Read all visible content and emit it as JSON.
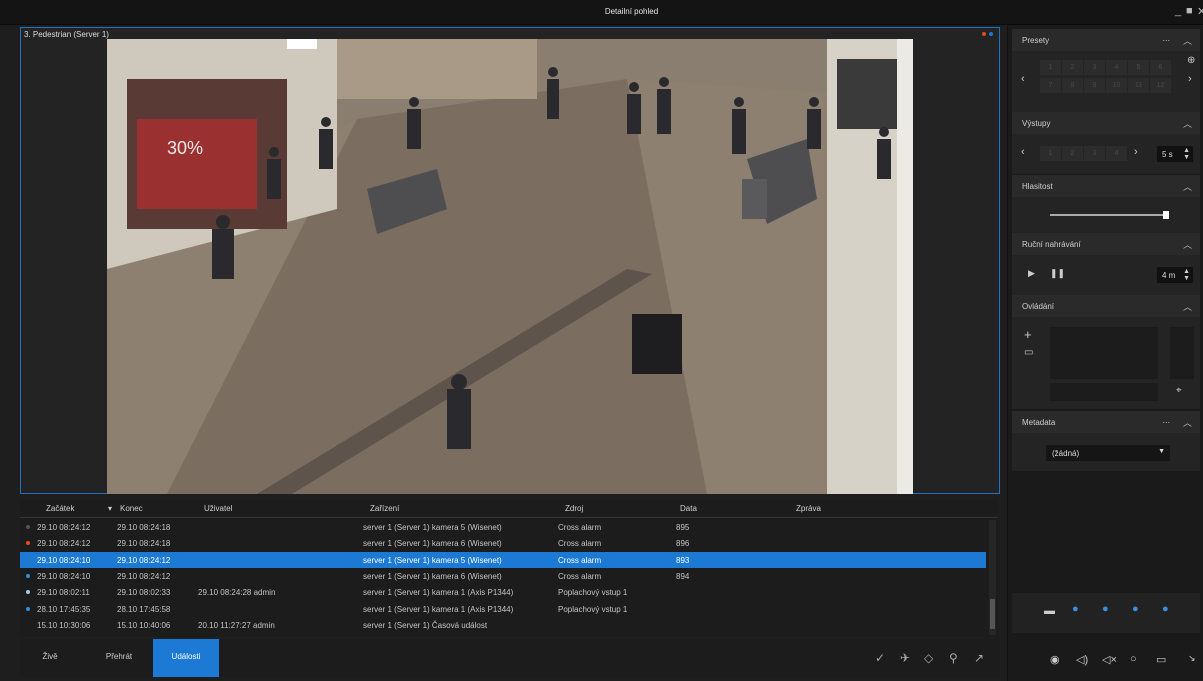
{
  "window": {
    "title": "Detailní pohled"
  },
  "camera": {
    "label": "3. Pedestrian (Server 1)"
  },
  "table": {
    "columns": [
      "Začátek",
      "Konec",
      "Uživatel",
      "Zařízení",
      "Zdroj",
      "Data",
      "Zpráva"
    ],
    "rows": [
      {
        "start": "29.10 08:24:12",
        "end": "29.10 08:24:18",
        "user": "",
        "device": "server 1 (Server 1)  kamera 5 (Wisenet)",
        "source": "Cross alarm",
        "data": "895",
        "message": "",
        "dot": "#555555"
      },
      {
        "start": "29.10 08:24:12",
        "end": "29.10 08:24:18",
        "user": "",
        "device": "server 1 (Server 1)  kamera 6 (Wisenet)",
        "source": "Cross alarm",
        "data": "896",
        "message": "",
        "dot": "#e04b1c"
      },
      {
        "start": "29.10 08:24:10",
        "end": "29.10 08:24:12",
        "user": "",
        "device": "server 1 (Server 1)  kamera 5 (Wisenet)",
        "source": "Cross alarm",
        "data": "893",
        "message": "",
        "dot": "#1c7ad4"
      },
      {
        "start": "29.10 08:24:10",
        "end": "29.10 08:24:12",
        "user": "",
        "device": "server 1 (Server 1)  kamera 6 (Wisenet)",
        "source": "Cross alarm",
        "data": "894",
        "message": "",
        "dot": "#2a8fe0"
      },
      {
        "start": "29.10 08:02:11",
        "end": "29.10 08:02:33",
        "user": "29.10 08:24:28  admin",
        "device": "server 1 (Server 1)  kamera 1 (Axis P1344)",
        "source": "Poplachový vstup 1",
        "data": "",
        "message": "",
        "dot": "#9ecbf0"
      },
      {
        "start": "28.10 17:45:35",
        "end": "28.10 17:45:58",
        "user": "",
        "device": "server 1 (Server 1)  kamera 1 (Axis P1344)",
        "source": "Poplachový vstup 1",
        "data": "",
        "message": "",
        "dot": "#2a8fe0"
      },
      {
        "start": "15.10 10:30:06",
        "end": "15.10 10:40:06",
        "user": "20.10 11:27:27  admin",
        "device": "server 1 (Server 1)  Časová událost",
        "source": "",
        "data": "",
        "message": "",
        "dot": ""
      }
    ]
  },
  "tabs": {
    "live": "Živě",
    "playback": "Přehrát",
    "events": "Události"
  },
  "panels": {
    "presets": {
      "title": "Presety",
      "more": "...",
      "cells": [
        "1",
        "2",
        "3",
        "4",
        "5",
        "6",
        "7",
        "8",
        "9",
        "10",
        "11",
        "12"
      ]
    },
    "outputs": {
      "title": "Výstupy",
      "cells": [
        "1",
        "2",
        "3",
        "4"
      ],
      "interval": "5 s"
    },
    "volume": {
      "title": "Hlasitost",
      "level": 1.0
    },
    "manual_recording": {
      "title": "Ruční nahrávání",
      "duration": "4 m"
    },
    "control": {
      "title": "Ovládání"
    },
    "metadata": {
      "title": "Metadata",
      "more": "...",
      "selected": "(žádná)"
    }
  },
  "colors": {
    "accent": "#1c7ad4",
    "alarm": "#e04b1c"
  }
}
